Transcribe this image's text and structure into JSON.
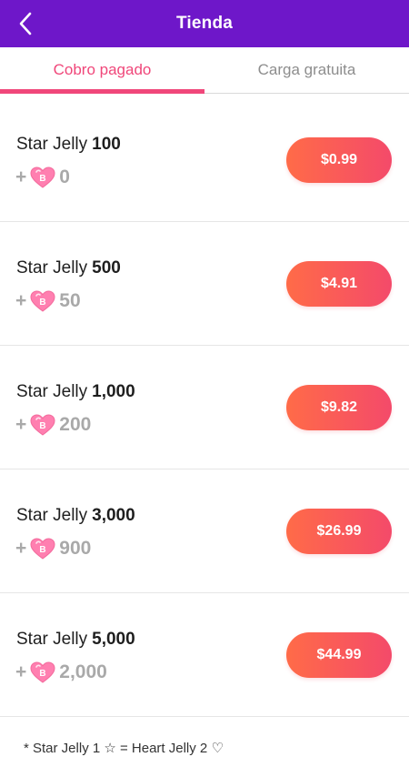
{
  "header": {
    "title": "Tienda",
    "back_icon": "chevron-left-icon"
  },
  "tabs": [
    {
      "label": "Cobro pagado",
      "active": true
    },
    {
      "label": "Carga gratuita",
      "active": false
    }
  ],
  "products": [
    {
      "name": "Star Jelly",
      "quantity": "100",
      "bonus_prefix": "+",
      "bonus": "0",
      "price": "$0.99"
    },
    {
      "name": "Star Jelly",
      "quantity": "500",
      "bonus_prefix": "+",
      "bonus": "50",
      "price": "$4.91"
    },
    {
      "name": "Star Jelly",
      "quantity": "1,000",
      "bonus_prefix": "+",
      "bonus": "200",
      "price": "$9.82"
    },
    {
      "name": "Star Jelly",
      "quantity": "3,000",
      "bonus_prefix": "+",
      "bonus": "900",
      "price": "$26.99"
    },
    {
      "name": "Star Jelly",
      "quantity": "5,000",
      "bonus_prefix": "+",
      "bonus": "2,000",
      "price": "$44.99"
    }
  ],
  "footnote": "* Star Jelly 1 ☆ = Heart Jelly 2 ♡",
  "colors": {
    "header_bg": "#6e17c9",
    "accent_pink": "#f0477a",
    "button_gradient_start": "#ff6b48",
    "button_gradient_end": "#f44a6a",
    "bonus_gray": "#a9a9a9"
  }
}
